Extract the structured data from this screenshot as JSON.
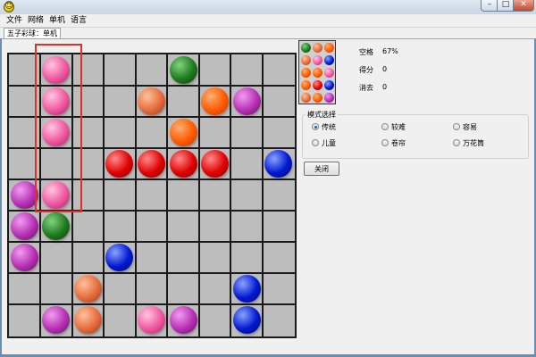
{
  "menu": {
    "items": [
      "文件",
      "网络",
      "单机",
      "语言"
    ]
  },
  "tab": {
    "label": "五子彩球：单机"
  },
  "board": {
    "rows": 9,
    "cols": 9,
    "balls": [
      {
        "row": 0,
        "col": 1,
        "color": "pink"
      },
      {
        "row": 0,
        "col": 5,
        "color": "green"
      },
      {
        "row": 1,
        "col": 1,
        "color": "pink"
      },
      {
        "row": 1,
        "col": 4,
        "color": "salmon"
      },
      {
        "row": 1,
        "col": 6,
        "color": "orange"
      },
      {
        "row": 1,
        "col": 7,
        "color": "purple"
      },
      {
        "row": 2,
        "col": 1,
        "color": "pink"
      },
      {
        "row": 2,
        "col": 5,
        "color": "orange"
      },
      {
        "row": 3,
        "col": 3,
        "color": "red"
      },
      {
        "row": 3,
        "col": 4,
        "color": "red"
      },
      {
        "row": 3,
        "col": 5,
        "color": "red"
      },
      {
        "row": 3,
        "col": 6,
        "color": "red"
      },
      {
        "row": 3,
        "col": 8,
        "color": "blue"
      },
      {
        "row": 4,
        "col": 0,
        "color": "purple"
      },
      {
        "row": 4,
        "col": 1,
        "color": "pink"
      },
      {
        "row": 5,
        "col": 0,
        "color": "purple"
      },
      {
        "row": 5,
        "col": 1,
        "color": "green"
      },
      {
        "row": 6,
        "col": 0,
        "color": "purple"
      },
      {
        "row": 6,
        "col": 3,
        "color": "blue"
      },
      {
        "row": 7,
        "col": 2,
        "color": "salmon"
      },
      {
        "row": 7,
        "col": 7,
        "color": "blue"
      },
      {
        "row": 8,
        "col": 1,
        "color": "purple"
      },
      {
        "row": 8,
        "col": 2,
        "color": "salmon"
      },
      {
        "row": 8,
        "col": 4,
        "color": "pink"
      },
      {
        "row": 8,
        "col": 5,
        "color": "purple"
      },
      {
        "row": 8,
        "col": 7,
        "color": "blue"
      }
    ]
  },
  "preview": {
    "balls": [
      "green",
      "salmon",
      "orange",
      "salmon",
      "pink",
      "blue",
      "orange",
      "orange",
      "pink",
      "orange",
      "red",
      "blue",
      "salmon",
      "orange",
      "purple"
    ]
  },
  "stats": {
    "empty_label": "空格",
    "empty_value": "67%",
    "score_label": "得分",
    "score_value": "0",
    "cleared_label": "消去",
    "cleared_value": "0"
  },
  "mode": {
    "legend": "模式选择",
    "options": [
      "传统",
      "较难",
      "容易",
      "儿童",
      "卷帘",
      "万花筒"
    ],
    "selected": "传统"
  },
  "close_button": {
    "label": "关闭"
  },
  "colors": {
    "pink": [
      "#ffc6e2",
      "#f0569e",
      "#a52162"
    ],
    "green": [
      "#7fd47f",
      "#1f7a1f",
      "#0a3d0a"
    ],
    "salmon": [
      "#ffc29a",
      "#e56b3d",
      "#9a3514"
    ],
    "orange": [
      "#ffb070",
      "#ff5a00",
      "#b33a00"
    ],
    "purple": [
      "#f19cf0",
      "#b52fb3",
      "#5c105c"
    ],
    "red": [
      "#ff8a8a",
      "#e00000",
      "#7a0000"
    ],
    "blue": [
      "#8aa2ff",
      "#0018d0",
      "#000b66"
    ]
  }
}
